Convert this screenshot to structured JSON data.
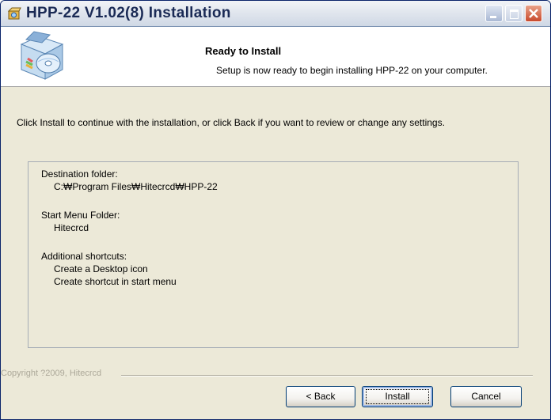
{
  "window": {
    "title": "HPP-22 V1.02(8) Installation"
  },
  "header": {
    "title": "Ready to Install",
    "description": "Setup is now ready to begin installing HPP-22 on your computer."
  },
  "intro_text": "Click Install to continue with the installation, or click Back if you want to review or change any settings.",
  "summary": {
    "destination_label": "Destination folder:",
    "destination_value": "C:\\Program Files\\Hitecrcd\\HPP-22",
    "destination_value_display": "C:₩Program Files₩Hitecrcd₩HPP-22",
    "start_menu_label": "Start Menu Folder:",
    "start_menu_value": "Hitecrcd",
    "shortcuts_label": "Additional shortcuts:",
    "shortcut_1": "Create a Desktop icon",
    "shortcut_2": "Create shortcut in start menu"
  },
  "footer": {
    "copyright": "Copyright ?2009, Hitecrcd"
  },
  "buttons": {
    "back": "< Back",
    "install": "Install",
    "cancel": "Cancel"
  },
  "icons": {
    "app": "installer-box-icon",
    "header": "installer-box-cd-icon",
    "minimize": "minimize-icon",
    "maximize": "maximize-icon",
    "close": "close-icon"
  },
  "colors": {
    "close_button": "#c8492c",
    "dialog_background": "#ece9d8",
    "header_background": "#ffffff"
  }
}
